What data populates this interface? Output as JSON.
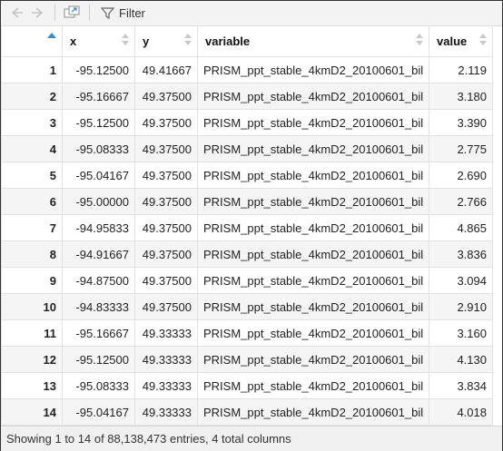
{
  "toolbar": {
    "back_icon": "arrow-left-icon",
    "forward_icon": "arrow-right-icon",
    "popout_icon": "popout-window-icon",
    "filter_icon": "funnel-icon",
    "filter_label": "Filter"
  },
  "table": {
    "columns": [
      "",
      "x",
      "y",
      "variable",
      "value"
    ],
    "sorted_column": "",
    "rows": [
      [
        "1",
        "-95.12500",
        "49.41667",
        "PRISM_ppt_stable_4kmD2_20100601_bil",
        "2.119"
      ],
      [
        "2",
        "-95.16667",
        "49.37500",
        "PRISM_ppt_stable_4kmD2_20100601_bil",
        "3.180"
      ],
      [
        "3",
        "-95.12500",
        "49.37500",
        "PRISM_ppt_stable_4kmD2_20100601_bil",
        "3.390"
      ],
      [
        "4",
        "-95.08333",
        "49.37500",
        "PRISM_ppt_stable_4kmD2_20100601_bil",
        "2.775"
      ],
      [
        "5",
        "-95.04167",
        "49.37500",
        "PRISM_ppt_stable_4kmD2_20100601_bil",
        "2.690"
      ],
      [
        "6",
        "-95.00000",
        "49.37500",
        "PRISM_ppt_stable_4kmD2_20100601_bil",
        "2.766"
      ],
      [
        "7",
        "-94.95833",
        "49.37500",
        "PRISM_ppt_stable_4kmD2_20100601_bil",
        "4.865"
      ],
      [
        "8",
        "-94.91667",
        "49.37500",
        "PRISM_ppt_stable_4kmD2_20100601_bil",
        "3.836"
      ],
      [
        "9",
        "-94.87500",
        "49.37500",
        "PRISM_ppt_stable_4kmD2_20100601_bil",
        "3.094"
      ],
      [
        "10",
        "-94.83333",
        "49.37500",
        "PRISM_ppt_stable_4kmD2_20100601_bil",
        "2.910"
      ],
      [
        "11",
        "-95.16667",
        "49.33333",
        "PRISM_ppt_stable_4kmD2_20100601_bil",
        "3.160"
      ],
      [
        "12",
        "-95.12500",
        "49.33333",
        "PRISM_ppt_stable_4kmD2_20100601_bil",
        "4.130"
      ],
      [
        "13",
        "-95.08333",
        "49.33333",
        "PRISM_ppt_stable_4kmD2_20100601_bil",
        "3.834"
      ],
      [
        "14",
        "-95.04167",
        "49.33333",
        "PRISM_ppt_stable_4kmD2_20100601_bil",
        "4.018"
      ]
    ]
  },
  "status": {
    "text": "Showing 1 to 14 of 88,138,473 entries, 4 total columns"
  },
  "colors": {
    "sort_active": "#2d8fd5",
    "sort_inactive": "#c8c8c8",
    "stripe": "#f5f5f5"
  }
}
